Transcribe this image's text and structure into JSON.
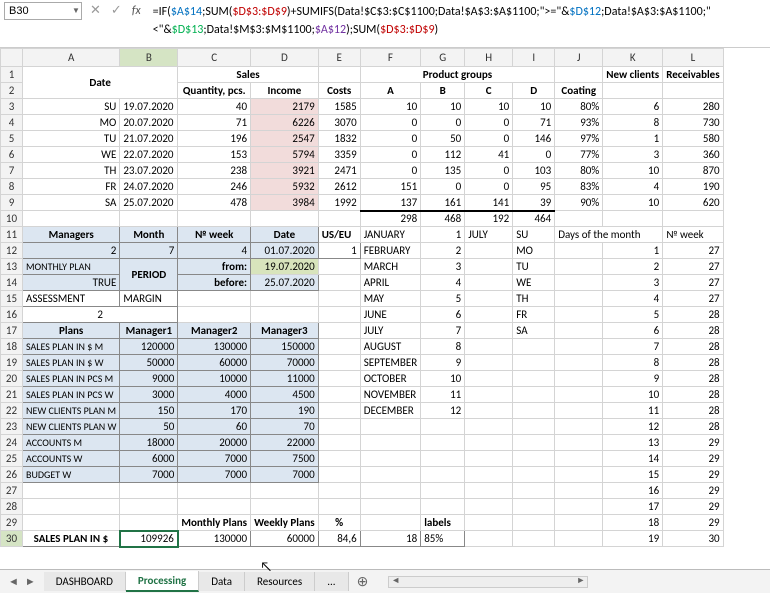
{
  "nameBox": "B30",
  "formula_parts": [
    {
      "cls": "k",
      "t": "=IF("
    },
    {
      "cls": "blue",
      "t": "$A$14"
    },
    {
      "cls": "k",
      "t": ";SUM("
    },
    {
      "cls": "red",
      "t": "$D$3:$D$9"
    },
    {
      "cls": "k",
      "t": ")+SUMIFS(Data!$C$3:$C$1100;Data!$A$3:$A$1100;\">=\"&"
    },
    {
      "cls": "blue",
      "t": "$D$12"
    },
    {
      "cls": "k",
      "t": ";Data!$A$3:$A$1100;\"<\"&"
    },
    {
      "cls": "green",
      "t": "$D$13"
    },
    {
      "cls": "k",
      "t": ";Data!$M$3:$M$1100;"
    },
    {
      "cls": "purple",
      "t": "$A$12"
    },
    {
      "cls": "k",
      "t": ");SUM("
    },
    {
      "cls": "red",
      "t": "$D$3:$D$9"
    },
    {
      "cls": "k",
      "t": ")"
    }
  ],
  "columns": [
    "A",
    "B",
    "C",
    "D",
    "E",
    "F",
    "G",
    "H",
    "I",
    "J",
    "K",
    "L"
  ],
  "headerRow1": {
    "date": "Date",
    "sales": "Sales",
    "pg": "Product groups",
    "new": "New clients",
    "recv": "Receivables"
  },
  "headerRow2": {
    "qty": "Quantity, pcs.",
    "inc": "Income",
    "costs": "Costs",
    "a": "A",
    "b": "B",
    "c": "C",
    "d": "D",
    "coat": "Coating"
  },
  "days": [
    {
      "dw": "SU",
      "date": "19.07.2020",
      "qty": 40,
      "inc": 2179,
      "cost": 1585,
      "a": 10,
      "b": 10,
      "c": 10,
      "d": 10,
      "coat": "80%",
      "nc": 6,
      "rv": 280
    },
    {
      "dw": "MO",
      "date": "20.07.2020",
      "qty": 71,
      "inc": 6226,
      "cost": 3070,
      "a": 0,
      "b": 0,
      "c": 0,
      "d": 71,
      "coat": "93%",
      "nc": 8,
      "rv": 730
    },
    {
      "dw": "TU",
      "date": "21.07.2020",
      "qty": 196,
      "inc": 2547,
      "cost": 1832,
      "a": 0,
      "b": 50,
      "c": 0,
      "d": 146,
      "coat": "97%",
      "nc": 1,
      "rv": 580
    },
    {
      "dw": "WE",
      "date": "22.07.2020",
      "qty": 153,
      "inc": 5794,
      "cost": 3359,
      "a": 0,
      "b": 112,
      "c": 41,
      "d": 0,
      "coat": "77%",
      "nc": 3,
      "rv": 360
    },
    {
      "dw": "TH",
      "date": "23.07.2020",
      "qty": 238,
      "inc": 3921,
      "cost": 2471,
      "a": 0,
      "b": 135,
      "c": 0,
      "d": 103,
      "coat": "80%",
      "nc": 10,
      "rv": 870
    },
    {
      "dw": "FR",
      "date": "24.07.2020",
      "qty": 246,
      "inc": 5932,
      "cost": 2612,
      "a": 151,
      "b": 0,
      "c": 0,
      "d": 95,
      "coat": "83%",
      "nc": 4,
      "rv": 190
    },
    {
      "dw": "SA",
      "date": "25.07.2020",
      "qty": 478,
      "inc": 3984,
      "cost": 1992,
      "a": 137,
      "b": 161,
      "c": 141,
      "d": 39,
      "coat": "90%",
      "nc": 10,
      "rv": 620
    }
  ],
  "totals": {
    "a": 298,
    "b": 468,
    "c": 192,
    "d": 464
  },
  "r11": {
    "mgr": "Managers",
    "month": "Month",
    "week": "№ week",
    "date": "Date",
    "useu": "US/EU",
    "jan": "JANUARY",
    "v1": 1,
    "jul": "JULY",
    "su": "SU",
    "dom": "Days of the month",
    "nw": "№ week"
  },
  "r12": {
    "v2": 2,
    "v7": 7,
    "v4": 4,
    "date": "01.07.2020",
    "v1": 1,
    "feb": "FEBRUARY",
    "vf": 2,
    "mo": "MO",
    "d1": 1,
    "d27": 27
  },
  "r13": {
    "mp": "MONTHLY PLAN",
    "period": "PERIOD",
    "from": "from:",
    "date": "19.07.2020",
    "mar": "MARCH",
    "v": 3,
    "tu": "TU",
    "d": 2,
    "d27": 27
  },
  "r14": {
    "true": "TRUE",
    "before": "before:",
    "date": "25.07.2020",
    "apr": "APRIL",
    "v": 4,
    "we": "WE",
    "d": 3,
    "d27": 27
  },
  "r15": {
    "ass": "ASSESSMENT",
    "margin": "MARGIN",
    "may": "MAY",
    "v": 5,
    "th": "TH",
    "d": 4,
    "d27": 27
  },
  "r16": {
    "v2": 2,
    "jun": "JUNE",
    "v": 6,
    "fr": "FR",
    "d": 5,
    "d28": 28
  },
  "r17": {
    "plans": "Plans",
    "m1": "Manager1",
    "m2": "Manager2",
    "m3": "Manager3",
    "jul": "JULY",
    "v": 7,
    "sa": "SA",
    "d": 6,
    "d28": 28
  },
  "planRows": [
    {
      "lbl": "SALES PLAN IN $ M",
      "m1": 120000,
      "m2": 130000,
      "m3": 150000,
      "mon": "AUGUST",
      "v": 8,
      "d": 7,
      "dk": 28
    },
    {
      "lbl": "SALES PLAN IN $ W",
      "m1": 50000,
      "m2": 60000,
      "m3": 70000,
      "mon": "SEPTEMBER",
      "v": 9,
      "d": 8,
      "dk": 28
    },
    {
      "lbl": "SALES PLAN IN PCS M",
      "m1": 9000,
      "m2": 10000,
      "m3": 11000,
      "mon": "OCTOBER",
      "v": 10,
      "d": 9,
      "dk": 28
    },
    {
      "lbl": "SALES PLAN IN PCS W",
      "m1": 3000,
      "m2": 4000,
      "m3": 4500,
      "mon": "NOVEMBER",
      "v": 11,
      "d": 10,
      "dk": 28
    },
    {
      "lbl": "NEW CLIENTS PLAN M",
      "m1": 150,
      "m2": 170,
      "m3": 190,
      "mon": "DECEMBER",
      "v": 12,
      "d": 11,
      "dk": 28
    },
    {
      "lbl": "NEW CLIENTS PLAN W",
      "m1": 50,
      "m2": 60,
      "m3": 70,
      "mon": "",
      "v": "",
      "d": 12,
      "dk": 28
    },
    {
      "lbl": "ACCOUNTS M",
      "m1": 18000,
      "m2": 20000,
      "m3": 22000,
      "mon": "",
      "v": "",
      "d": 13,
      "dk": 29
    },
    {
      "lbl": "ACCOUNTS W",
      "m1": 6000,
      "m2": 7000,
      "m3": 7500,
      "mon": "",
      "v": "",
      "d": 14,
      "dk": 29
    },
    {
      "lbl": "BUDGET W",
      "m1": 7000,
      "m2": 7000,
      "m3": 7000,
      "mon": "",
      "v": "",
      "d": 15,
      "dk": 29
    }
  ],
  "r27": {
    "d": 16,
    "dk": 29
  },
  "r28": {
    "d": 17,
    "dk": 29
  },
  "r29": {
    "mp": "Monthly Plans",
    "wp": "Weekly Plans",
    "pct": "%",
    "lbl": "labels",
    "d": 18,
    "dk": 29
  },
  "r30": {
    "sp": "SALES PLAN IN $",
    "v": 109926,
    "mp": 130000,
    "wp": 60000,
    "pct": "84,6",
    "lv": 18,
    "lbl": "85%",
    "d": 19,
    "dk": 30
  },
  "tabs": [
    "DASHBOARD",
    "Processing",
    "Data",
    "Resources",
    "..."
  ],
  "activeTab": 1
}
